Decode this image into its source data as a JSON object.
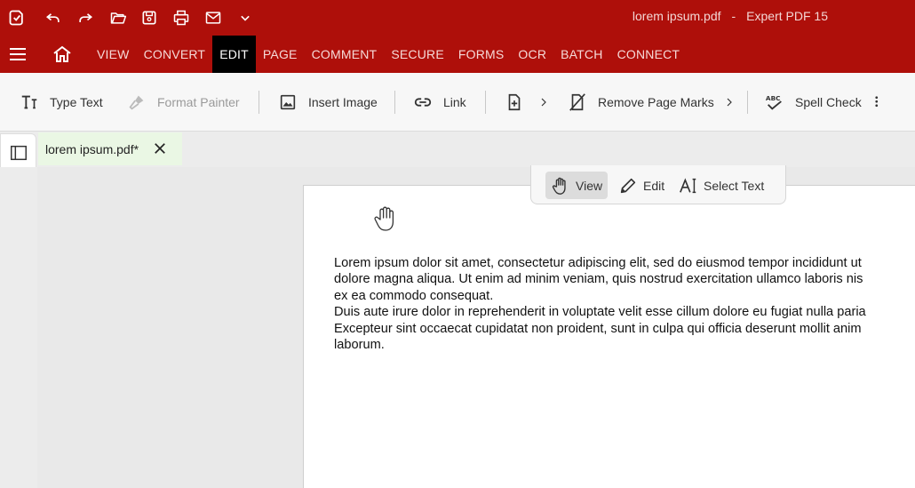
{
  "window": {
    "file_name": "lorem ipsum.pdf",
    "separator": "-",
    "app_name": "Expert PDF 15"
  },
  "menu": {
    "items": [
      {
        "label": "VIEW"
      },
      {
        "label": "CONVERT"
      },
      {
        "label": "EDIT"
      },
      {
        "label": "PAGE"
      },
      {
        "label": "COMMENT"
      },
      {
        "label": "SECURE"
      },
      {
        "label": "FORMS"
      },
      {
        "label": "OCR"
      },
      {
        "label": "BATCH"
      },
      {
        "label": "CONNECT"
      }
    ],
    "active": "EDIT"
  },
  "ribbon": {
    "type_text": "Type Text",
    "format_painter": "Format Painter",
    "insert_image": "Insert Image",
    "link": "Link",
    "remove_page_marks": "Remove Page Marks",
    "spell_check": "Spell Check"
  },
  "doc_tab": {
    "title": "lorem ipsum.pdf*"
  },
  "mode_toolbar": {
    "view": "View",
    "edit": "Edit",
    "select_text": "Select Text",
    "active": "View"
  },
  "document": {
    "lines": [
      "Lorem ipsum dolor sit amet, consectetur adipiscing elit, sed do eiusmod tempor incididunt ut",
      "dolore magna aliqua. Ut enim ad minim veniam, quis nostrud exercitation ullamco laboris nis",
      "ex ea commodo consequat.",
      "Duis aute irure dolor in reprehenderit in voluptate velit esse cillum dolore eu fugiat nulla paria",
      "Excepteur sint occaecat cupidatat non proident, sunt in culpa qui officia deserunt mollit anim",
      "laborum."
    ]
  },
  "colors": {
    "brand": "#ae0f0a",
    "active_menu": "#000000",
    "doc_tab": "#eaf7e4"
  }
}
